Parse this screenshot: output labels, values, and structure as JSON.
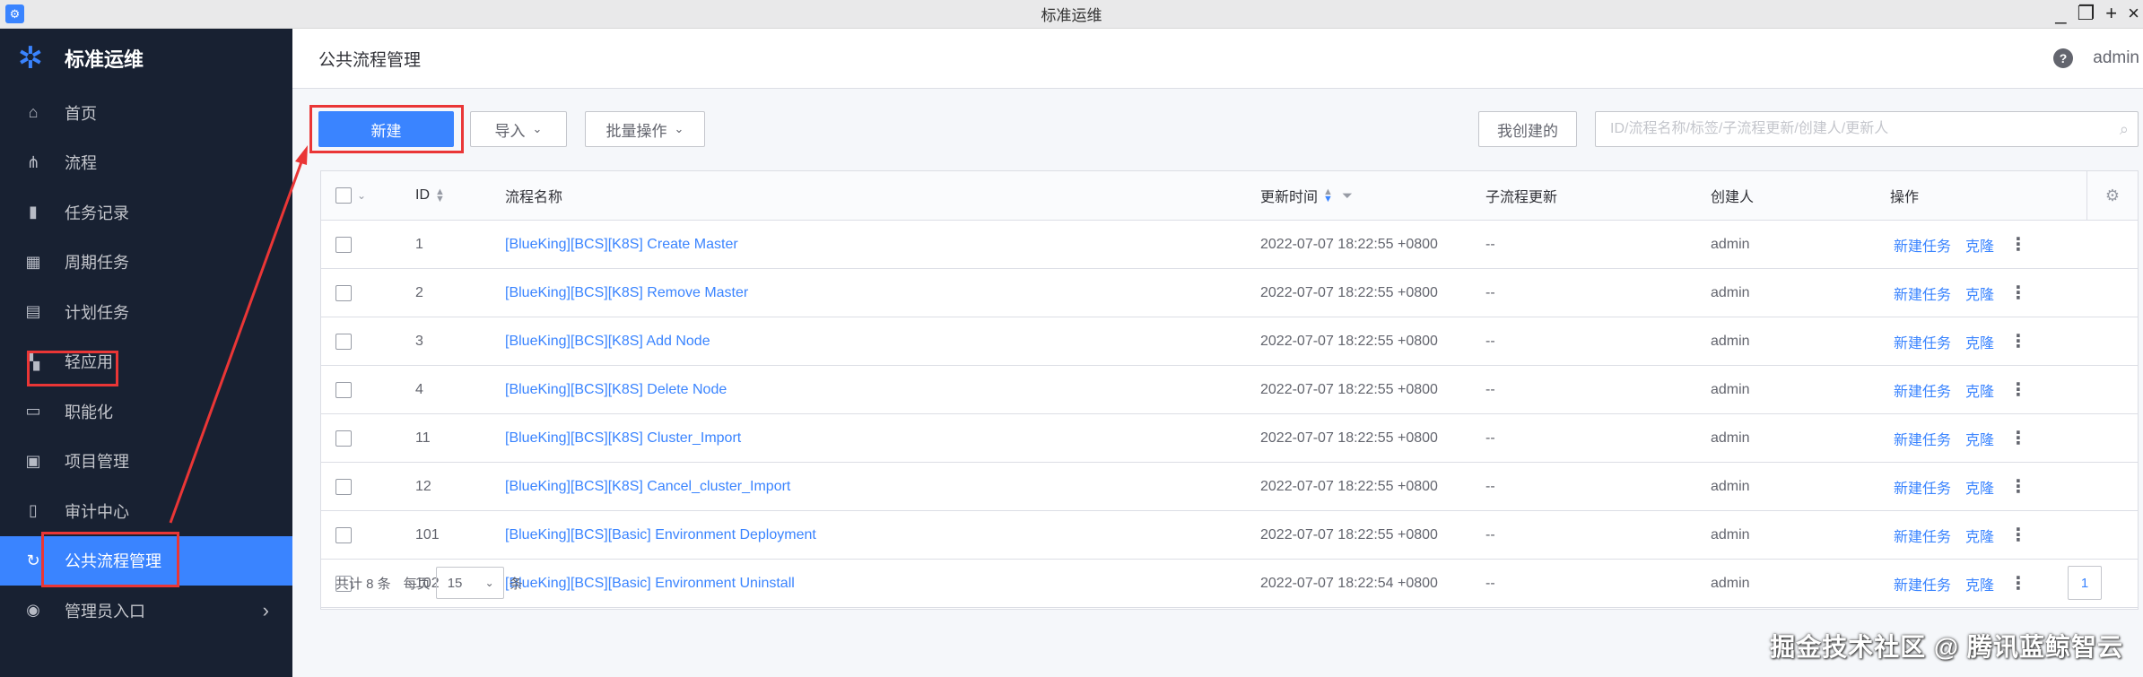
{
  "window": {
    "title": "标准运维",
    "controls": [
      "_",
      "❐",
      "+",
      "×"
    ]
  },
  "brand": {
    "name": "标准运维"
  },
  "sidebar": {
    "items": [
      {
        "label": "首页",
        "icon": "home-icon",
        "glyph": "⌂"
      },
      {
        "label": "流程",
        "icon": "flow-icon",
        "glyph": "⋔"
      },
      {
        "label": "任务记录",
        "icon": "bookmark-icon",
        "glyph": "▮"
      },
      {
        "label": "周期任务",
        "icon": "calendar-icon",
        "glyph": "▦"
      },
      {
        "label": "计划任务",
        "icon": "plan-icon",
        "glyph": "▤"
      },
      {
        "label": "轻应用",
        "icon": "apps-icon",
        "glyph": "▚"
      },
      {
        "label": "职能化",
        "icon": "functional-icon",
        "glyph": "▭"
      },
      {
        "label": "项目管理",
        "icon": "project-icon",
        "glyph": "▣"
      },
      {
        "label": "审计中心",
        "icon": "clipboard-icon",
        "glyph": "▯"
      },
      {
        "label": "公共流程管理",
        "icon": "refresh-icon",
        "glyph": "↻",
        "active": true
      },
      {
        "label": "管理员入口",
        "icon": "admin-icon",
        "glyph": "◉",
        "has_chevron": true
      }
    ]
  },
  "header": {
    "title": "公共流程管理",
    "help": "?",
    "user": "admin"
  },
  "toolbar": {
    "new_label": "新建",
    "import_label": "导入",
    "batch_label": "批量操作",
    "mine_label": "我创建的",
    "search_placeholder": "ID/流程名称/标签/子流程更新/创建人/更新人"
  },
  "table": {
    "columns": {
      "id": "ID",
      "name": "流程名称",
      "updated": "更新时间",
      "subflow": "子流程更新",
      "creator": "创建人",
      "actions": "操作"
    },
    "rows": [
      {
        "id": "1",
        "name": "[BlueKing][BCS][K8S] Create Master",
        "updated": "2022-07-07 18:22:55 +0800",
        "subflow": "--",
        "creator": "admin"
      },
      {
        "id": "2",
        "name": "[BlueKing][BCS][K8S] Remove Master",
        "updated": "2022-07-07 18:22:55 +0800",
        "subflow": "--",
        "creator": "admin"
      },
      {
        "id": "3",
        "name": "[BlueKing][BCS][K8S] Add Node",
        "updated": "2022-07-07 18:22:55 +0800",
        "subflow": "--",
        "creator": "admin"
      },
      {
        "id": "4",
        "name": "[BlueKing][BCS][K8S] Delete Node",
        "updated": "2022-07-07 18:22:55 +0800",
        "subflow": "--",
        "creator": "admin"
      },
      {
        "id": "11",
        "name": "[BlueKing][BCS][K8S] Cluster_Import",
        "updated": "2022-07-07 18:22:55 +0800",
        "subflow": "--",
        "creator": "admin"
      },
      {
        "id": "12",
        "name": "[BlueKing][BCS][K8S] Cancel_cluster_Import",
        "updated": "2022-07-07 18:22:55 +0800",
        "subflow": "--",
        "creator": "admin"
      },
      {
        "id": "101",
        "name": "[BlueKing][BCS][Basic] Environment Deployment",
        "updated": "2022-07-07 18:22:55 +0800",
        "subflow": "--",
        "creator": "admin"
      },
      {
        "id": "102",
        "name": "[BlueKing][BCS][Basic] Environment Uninstall",
        "updated": "2022-07-07 18:22:54 +0800",
        "subflow": "--",
        "creator": "admin"
      }
    ],
    "row_action_new": "新建任务",
    "row_action_clone": "克隆",
    "row_action_more": "⋮"
  },
  "pager": {
    "total": "共计 8 条",
    "per_page_label": "每页",
    "per_page_value": "15",
    "unit": "条",
    "current_page": "1"
  },
  "watermark": "掘金技术社区 @ 腾讯蓝鲸智云",
  "colors": {
    "primary": "#3a84ff",
    "sidebar_bg": "#182132",
    "annotation": "#ea3636"
  }
}
